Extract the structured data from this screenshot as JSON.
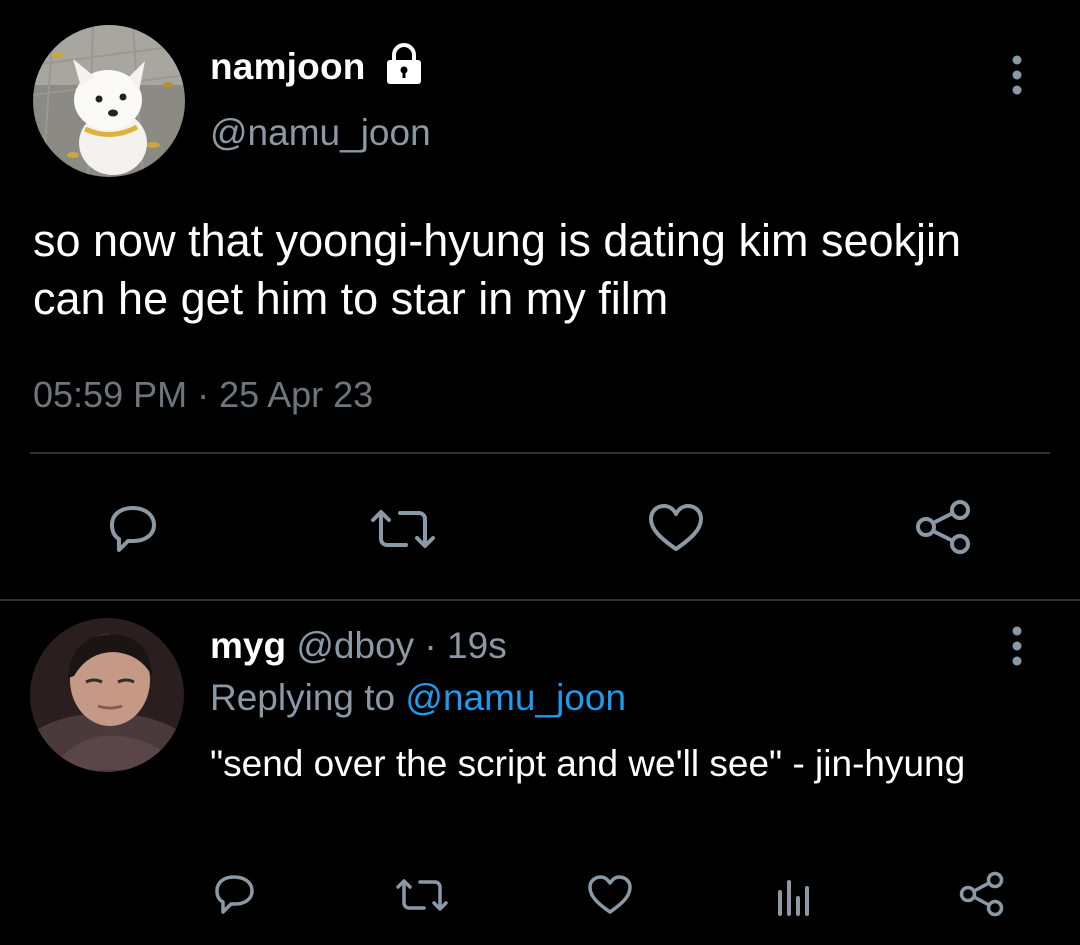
{
  "tweet": {
    "display_name": "namjoon",
    "handle": "@namu_joon",
    "text": "so now that yoongi-hyung is dating kim seokjin can he get him to star in my film",
    "timestamp": "05:59 PM · 25 Apr 23",
    "actions": [
      "reply-icon",
      "retweet-icon",
      "like-icon",
      "share-icon"
    ]
  },
  "reply": {
    "display_name": "myg",
    "handle": "@dboy",
    "separator": " · ",
    "time": "19s",
    "replying_label": "Replying to ",
    "replying_to": "@namu_joon",
    "text": "\"send over the script and we'll see\" - jin-hyung",
    "actions": [
      "reply-icon",
      "retweet-icon",
      "like-icon",
      "analytics-icon",
      "share-icon"
    ]
  },
  "colors": {
    "background": "#000000",
    "text_primary": "#ffffff",
    "text_secondary": "#8b98a5",
    "accent": "#1d9bf0",
    "icon": "#8b98a5",
    "divider": "#2f3336"
  }
}
